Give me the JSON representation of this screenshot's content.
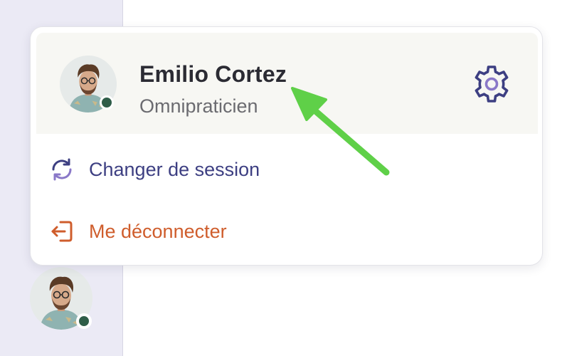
{
  "profile": {
    "name": "Emilio Cortez",
    "role": "Omnipraticien",
    "avatar_icon": "user-avatar-photo",
    "status": "online"
  },
  "menu": {
    "switch_session": {
      "label": "Changer de session",
      "icon": "refresh-icon"
    },
    "logout": {
      "label": "Me déconnecter",
      "icon": "logout-icon"
    },
    "settings_icon": "gear-icon"
  },
  "colors": {
    "accent": "#3d3f82",
    "danger": "#cf5d2c",
    "status_online": "#2f5d48",
    "annotation_arrow": "#5fd048",
    "sidebar_bg": "#ebeaf5",
    "profile_bg": "#f7f7f3"
  }
}
